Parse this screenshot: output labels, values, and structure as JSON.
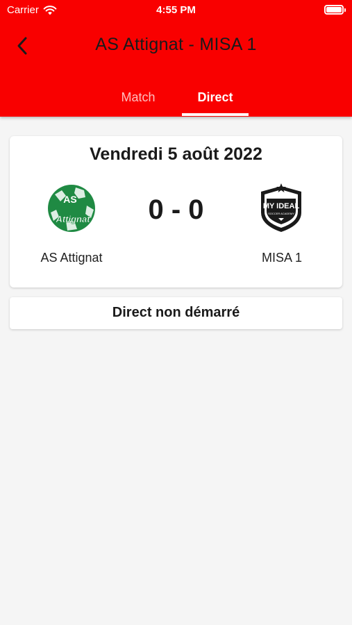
{
  "status_bar": {
    "carrier": "Carrier",
    "time": "4:55 PM"
  },
  "header": {
    "title": "AS Attignat - MISA 1",
    "back_icon": "chevron-left-icon",
    "background_color": "#f90000"
  },
  "tabs": [
    {
      "label": "Match",
      "active": false
    },
    {
      "label": "Direct",
      "active": true
    }
  ],
  "match": {
    "date": "Vendredi 5 août 2022",
    "score": "0 - 0",
    "home": {
      "name": "AS Attignat",
      "logo_text_top": "AS",
      "logo_text_bottom": "Attignat",
      "logo_color": "#1f8a43"
    },
    "away": {
      "name": "MISA 1",
      "logo_text": "MY IDEAL",
      "logo_subtext": "SOCCER ACADEMY",
      "logo_color": "#1a1a1a"
    }
  },
  "live": {
    "status_text": "Direct non démarré"
  }
}
